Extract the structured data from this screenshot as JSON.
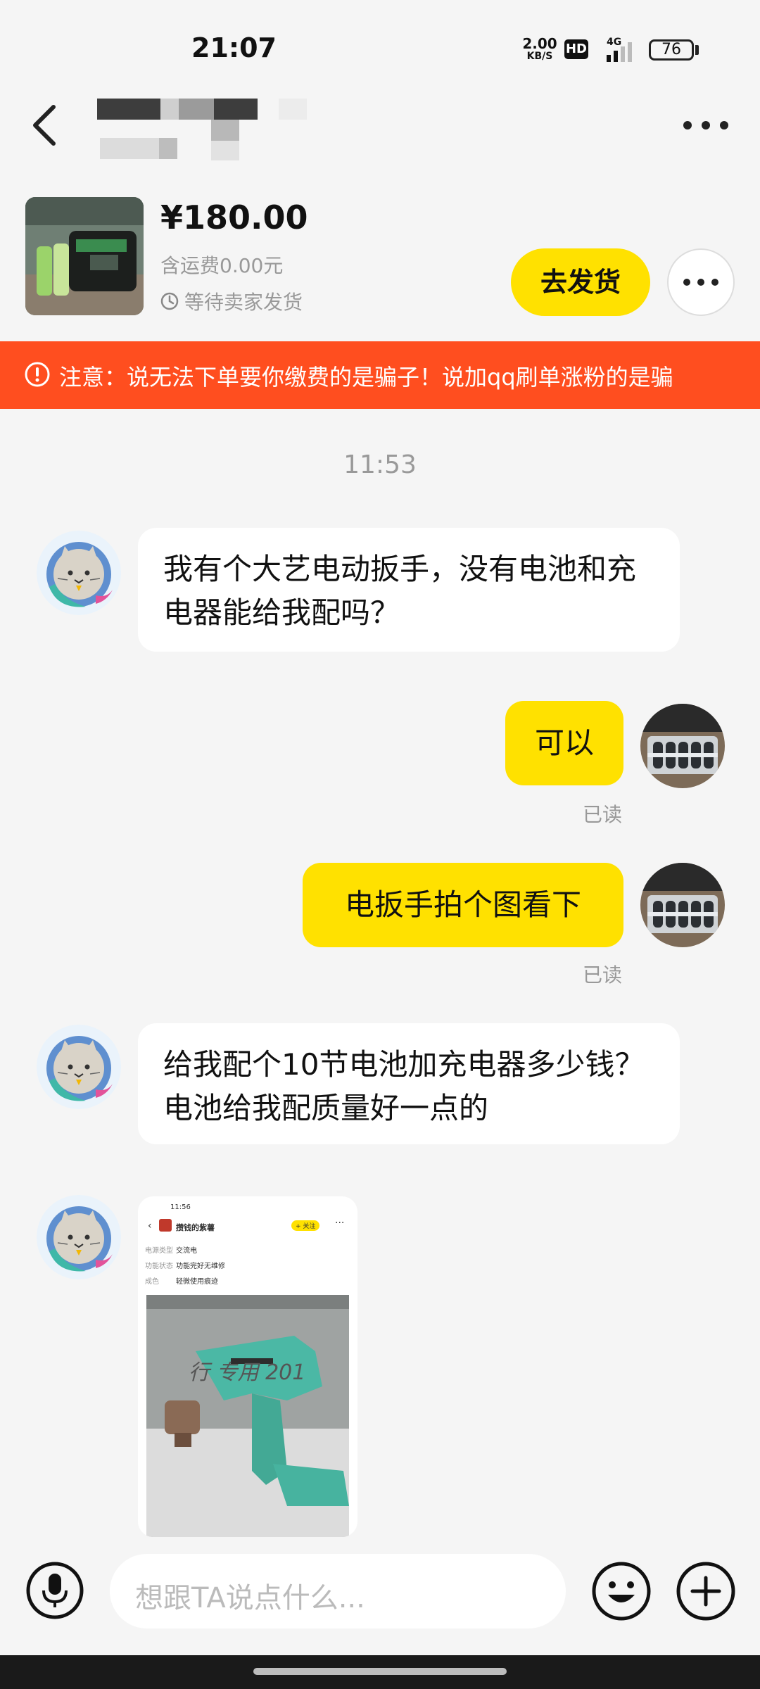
{
  "status_bar": {
    "time": "21:07",
    "net_speed": "2.00",
    "net_unit": "KB/S",
    "hd": "HD",
    "network": "4G",
    "battery": "76"
  },
  "product": {
    "price": "¥180.00",
    "shipping": "含运费0.00元",
    "status": "等待卖家发货",
    "ship_button": "去发货"
  },
  "warning": {
    "text": "注意：说无法下单要你缴费的是骗子！说加qq刷单涨粉的是骗"
  },
  "chat": {
    "timestamp": "11:53",
    "messages": [
      {
        "side": "left",
        "text": "我有个大艺电动扳手，没有电池和充电器能给我配吗？"
      },
      {
        "side": "right",
        "text": "可以",
        "read": "已读"
      },
      {
        "side": "right",
        "text": "电扳手拍个图看下",
        "read": "已读"
      },
      {
        "side": "left",
        "text": "给我配个10节电池加充电器多少钱？电池给我配质量好一点的"
      }
    ],
    "image_message": {
      "time": "11:56",
      "shop_name": "攒钱的紫薯",
      "follow": "+ 关注",
      "rows": [
        {
          "k": "电源类型",
          "v": "交流电"
        },
        {
          "k": "功能状态",
          "v": "功能完好无维修"
        },
        {
          "k": "成色",
          "v": "轻微使用痕迹"
        }
      ],
      "photo_text": "行  专用 201"
    }
  },
  "input": {
    "placeholder": "想跟TA说点什么..."
  },
  "colors": {
    "accent": "#ffe100",
    "warning": "#ff4e1f",
    "background": "#f5f5f5"
  },
  "icons": [
    "back-icon",
    "more-icon",
    "clock-icon",
    "warning-icon",
    "microphone-icon",
    "emoji-icon",
    "plus-icon"
  ]
}
